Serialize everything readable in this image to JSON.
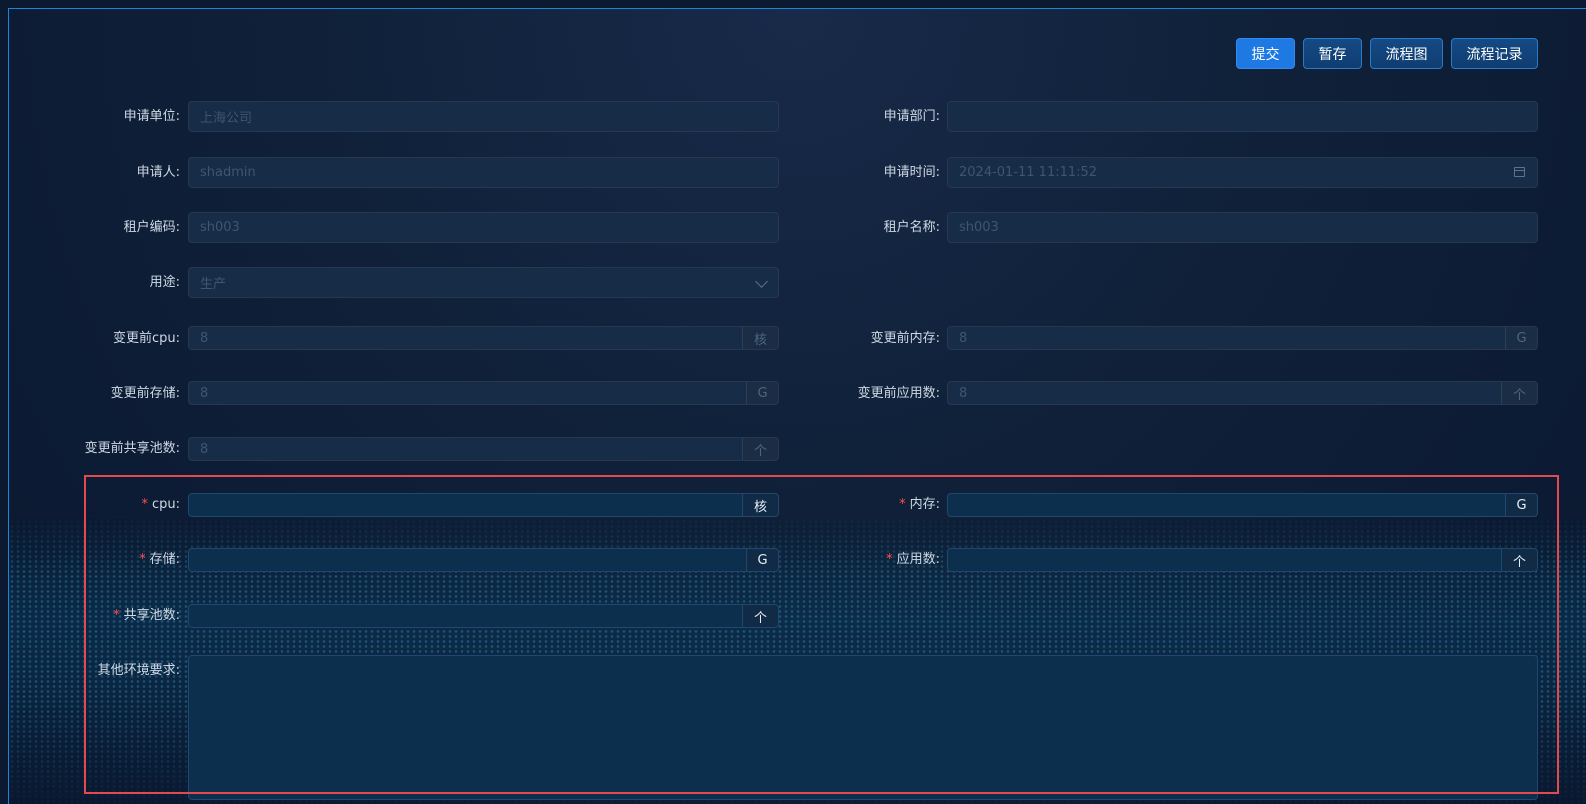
{
  "toolbar": {
    "submit_label": "提交",
    "save_draft_label": "暂存",
    "flowchart_label": "流程图",
    "flow_record_label": "流程记录"
  },
  "form": {
    "apply_unit": {
      "label": "申请单位",
      "value": "上海公司"
    },
    "apply_dept": {
      "label": "申请部门",
      "value": ""
    },
    "applicant": {
      "label": "申请人",
      "value": "shadmin"
    },
    "apply_time": {
      "label": "申请时间",
      "value": "2024-01-11 11:11:52",
      "icon": "calendar-icon"
    },
    "tenant_code": {
      "label": "租户编码",
      "value": "sh003"
    },
    "tenant_name": {
      "label": "租户名称",
      "value": "sh003"
    },
    "usage": {
      "label": "用途",
      "value": "生产",
      "icon": "chevron-down-icon"
    },
    "before_cpu": {
      "label": "变更前cpu",
      "value": "8",
      "unit": "核"
    },
    "before_memory": {
      "label": "变更前内存",
      "value": "8",
      "unit": "G"
    },
    "before_storage": {
      "label": "变更前存储",
      "value": "8",
      "unit": "G"
    },
    "before_apps": {
      "label": "变更前应用数",
      "value": "8",
      "unit": "个"
    },
    "before_pools": {
      "label": "变更前共享池数",
      "value": "8",
      "unit": "个"
    },
    "cpu": {
      "label": "cpu",
      "required_mark": "*",
      "value": "",
      "unit": "核"
    },
    "memory": {
      "label": "内存",
      "required_mark": "*",
      "value": "",
      "unit": "G"
    },
    "storage": {
      "label": "存储",
      "required_mark": "*",
      "value": "",
      "unit": "G"
    },
    "apps": {
      "label": "应用数",
      "required_mark": "*",
      "value": "",
      "unit": "个"
    },
    "pools": {
      "label": "共享池数",
      "required_mark": "*",
      "value": "",
      "unit": "个"
    },
    "other_requirements": {
      "label": "其他环境要求",
      "value": ""
    }
  },
  "colors": {
    "accent": "#1f79e3",
    "highlight_border": "#e24a4f",
    "required": "#ff4d4f"
  }
}
